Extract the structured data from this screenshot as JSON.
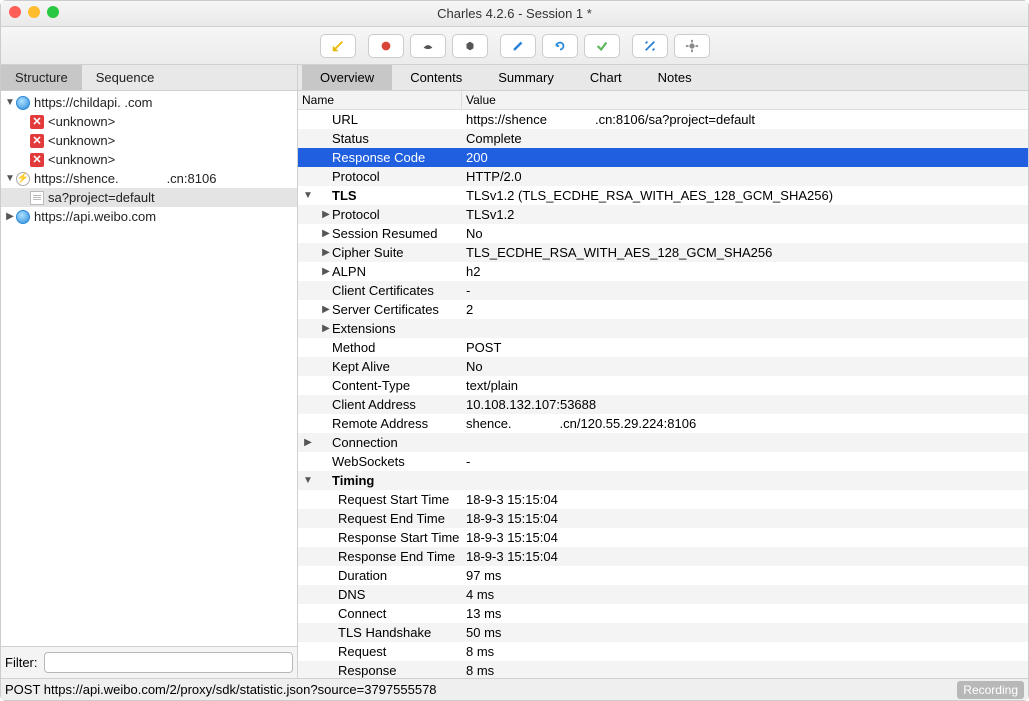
{
  "title": "Charles 4.2.6 - Session 1 *",
  "toolbarIcons": [
    "broom",
    "record",
    "turtle",
    "hex",
    "pencil",
    "refresh",
    "check",
    "tools",
    "gear"
  ],
  "leftTabs": {
    "structure": "Structure",
    "sequence": "Sequence"
  },
  "tree": {
    "host1": "https://childapi.            .com",
    "unknown": "<unknown>",
    "host2a": "https://shence.",
    "host2b": ".cn:8106",
    "request1": "sa?project=default",
    "host3": "https://api.weibo.com"
  },
  "filterLabel": "Filter:",
  "rightTabs": [
    "Overview",
    "Contents",
    "Summary",
    "Chart",
    "Notes"
  ],
  "gridHead": {
    "name": "Name",
    "value": "Value"
  },
  "overview": {
    "URL_label": "URL",
    "URL_value_a": "https://shence",
    "URL_value_b": ".cn:8106/sa?project=default",
    "Status_label": "Status",
    "Status_value": "Complete",
    "ResponseCode_label": "Response Code",
    "ResponseCode_value": "200",
    "Protocol_label": "Protocol",
    "Protocol_value": "HTTP/2.0",
    "TLS_label": "TLS",
    "TLS_value": "TLSv1.2 (TLS_ECDHE_RSA_WITH_AES_128_GCM_SHA256)",
    "TLS_Protocol_label": "Protocol",
    "TLS_Protocol_value": "TLSv1.2",
    "TLS_Session_label": "Session Resumed",
    "TLS_Session_value": "No",
    "TLS_Cipher_label": "Cipher Suite",
    "TLS_Cipher_value": "TLS_ECDHE_RSA_WITH_AES_128_GCM_SHA256",
    "TLS_ALPN_label": "ALPN",
    "TLS_ALPN_value": "h2",
    "TLS_Client_label": "Client Certificates",
    "TLS_Client_value": "-",
    "TLS_Server_label": "Server Certificates",
    "TLS_Server_value": "2",
    "TLS_Ext_label": "Extensions",
    "TLS_Ext_value": "",
    "Method_label": "Method",
    "Method_value": "POST",
    "KeptAlive_label": "Kept Alive",
    "KeptAlive_value": "No",
    "ContentType_label": "Content-Type",
    "ContentType_value": "text/plain",
    "ClientAddr_label": "Client Address",
    "ClientAddr_value": "10.108.132.107:53688",
    "RemoteAddr_label": "Remote Address",
    "RemoteAddr_value_a": "shence.",
    "RemoteAddr_value_b": ".cn/120.55.29.224:8106",
    "Connection_label": "Connection",
    "Connection_value": "",
    "WebSockets_label": "WebSockets",
    "WebSockets_value": "-",
    "Timing_label": "Timing",
    "Timing_value": "",
    "ReqStart_label": "Request Start Time",
    "ReqStart_value": "18-9-3 15:15:04",
    "ReqEnd_label": "Request End Time",
    "ReqEnd_value": "18-9-3 15:15:04",
    "RespStart_label": "Response Start Time",
    "RespStart_value": "18-9-3 15:15:04",
    "RespEnd_label": "Response End Time",
    "RespEnd_value": "18-9-3 15:15:04",
    "Duration_label": "Duration",
    "Duration_value": "97 ms",
    "DNS_label": "DNS",
    "DNS_value": "4 ms",
    "Connect_label": "Connect",
    "Connect_value": "13 ms",
    "TLSHand_label": "TLS Handshake",
    "TLSHand_value": "50 ms",
    "Request_label": "Request",
    "Request_value": "8 ms",
    "Response_label": "Response",
    "Response_value": "8 ms"
  },
  "statusText": "POST https://api.weibo.com/2/proxy/sdk/statistic.json?source=3797555578",
  "recordingLabel": "Recording"
}
